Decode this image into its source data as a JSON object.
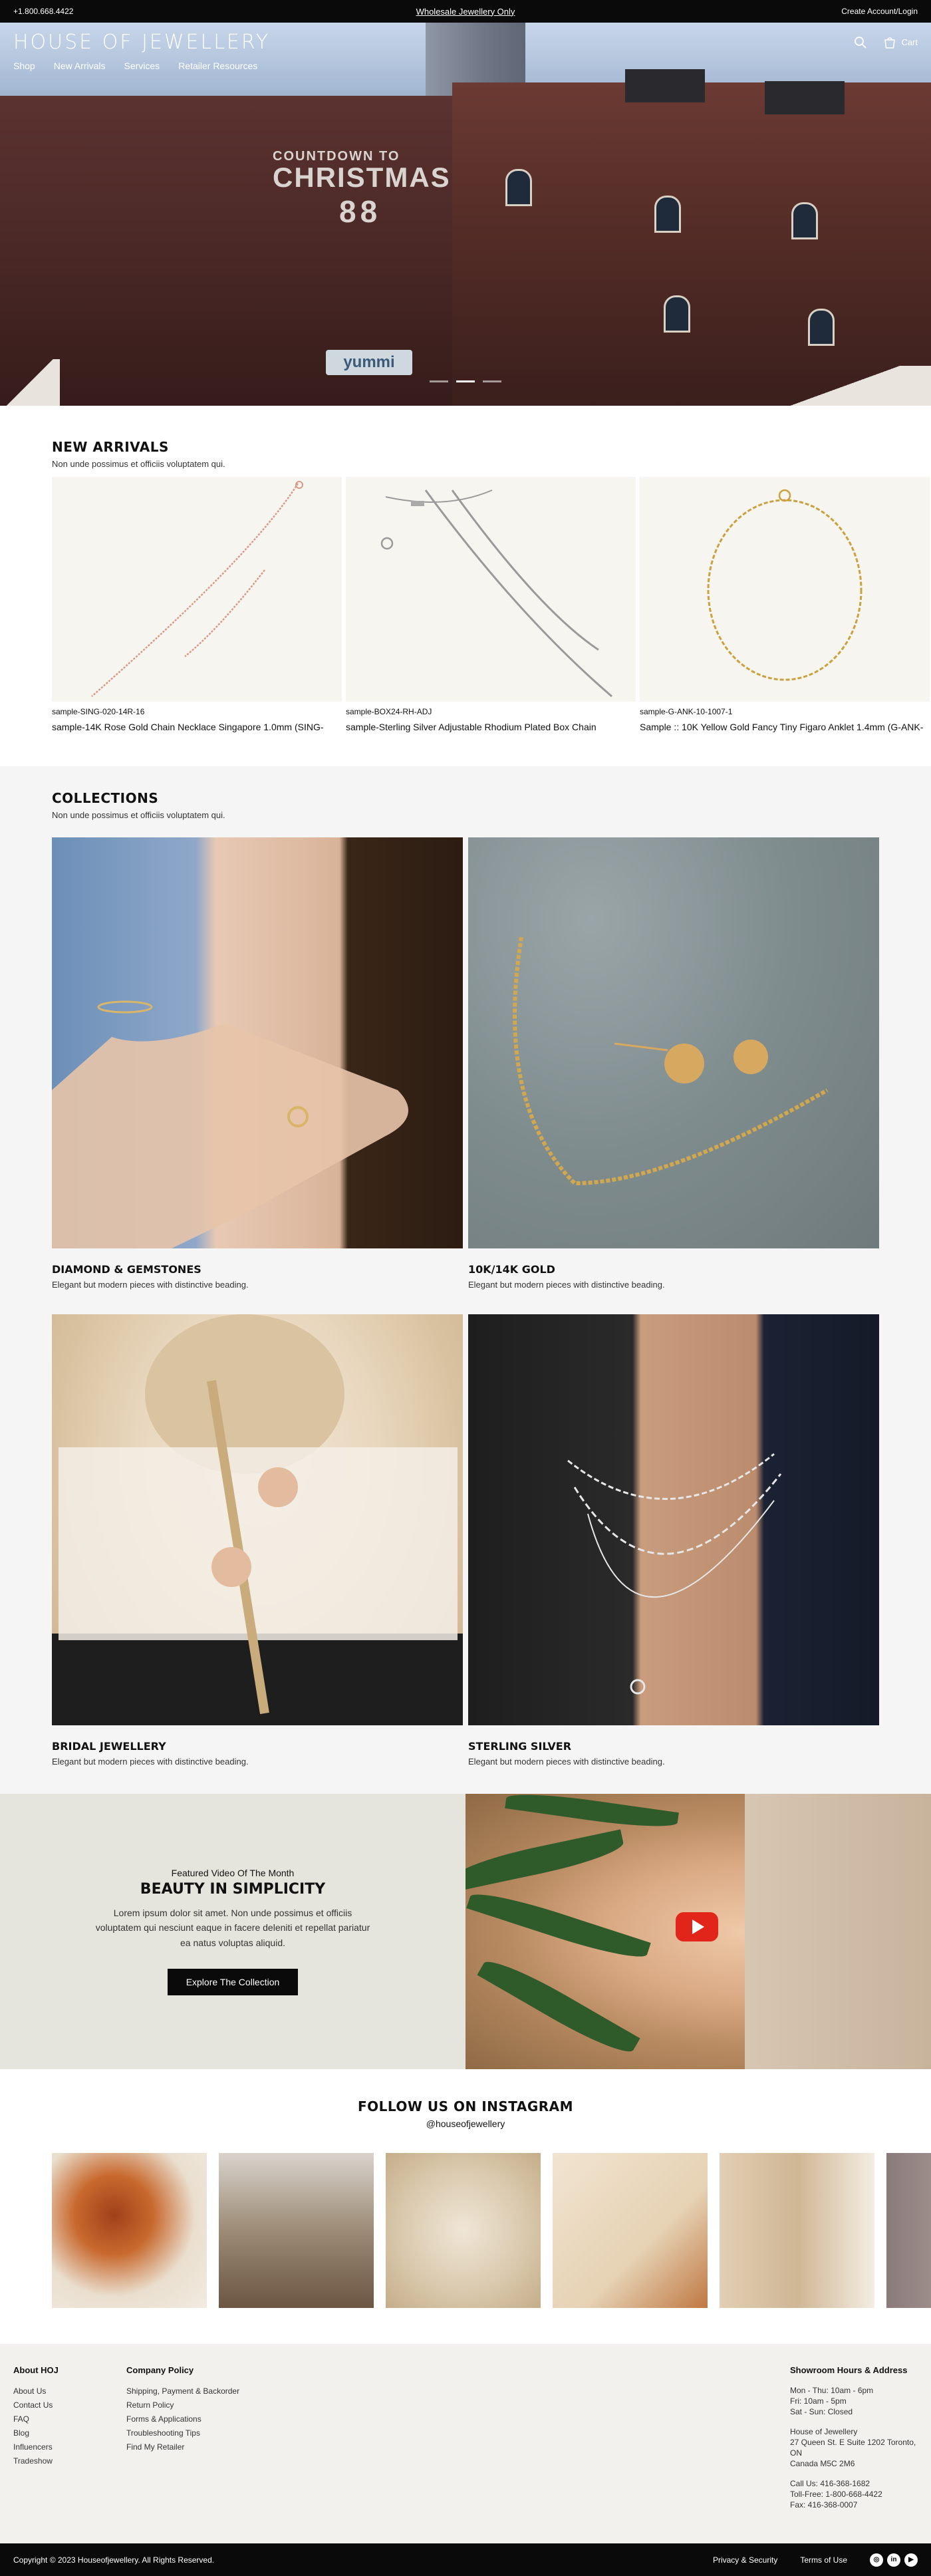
{
  "topbar": {
    "phone": "+1.800.668.4422",
    "wholesale_link": "Wholesale Jewellery Only",
    "account_link": "Create Account/Login"
  },
  "header": {
    "logo": "HOUSE OF JEWELLERY",
    "menu": [
      "Shop",
      "New Arrivals",
      "Services",
      "Retailer Resources"
    ],
    "cart_label": "Cart",
    "icons": [
      "search-icon",
      "cart-icon"
    ]
  },
  "hero": {
    "sign_line1": "COUNTDOWN TO",
    "sign_line2": "CHRISTMAS",
    "sign_line3": "88",
    "storefront_sign": "yummi",
    "slides": 3,
    "active_slide": 2
  },
  "new_arrivals": {
    "title": "NEW ARRIVALS",
    "subtitle": "Non unde possimus et officiis voluptatem qui.",
    "products": [
      {
        "sku": "sample-SING-020-14R-16",
        "name": "sample-14K Rose Gold Chain Necklace Singapore 1.0mm (SING-"
      },
      {
        "sku": "sample-BOX24-RH-ADJ",
        "name": "sample-Sterling Silver Adjustable Rhodium Plated Box Chain"
      },
      {
        "sku": "sample-G-ANK-10-1007-1",
        "name": "Sample :: 10K Yellow Gold Fancy Tiny Figaro Anklet 1.4mm (G-ANK-"
      }
    ]
  },
  "collections": {
    "title": "COLLECTIONS",
    "subtitle": "Non unde possimus et officiis voluptatem qui.",
    "items": [
      {
        "title": "DIAMOND & GEMSTONES",
        "desc": "Elegant but modern pieces with distinctive beading."
      },
      {
        "title": "10K/14K GOLD",
        "desc": "Elegant but modern pieces with distinctive beading."
      },
      {
        "title": "BRIDAL JEWELLERY",
        "desc": "Elegant but modern pieces with distinctive beading."
      },
      {
        "title": "STERLING SILVER",
        "desc": "Elegant but modern pieces with distinctive beading."
      }
    ]
  },
  "video": {
    "kicker": "Featured Video Of The Month",
    "title": "BEAUTY IN SIMPLICITY",
    "text": "Lorem ipsum dolor sit amet. Non unde possimus et officiis voluptatem qui nesciunt eaque in facere deleniti et repellat pariatur ea natus voluptas aliquid.",
    "button": "Explore The Collection"
  },
  "instagram": {
    "title": "FOLLOW US ON INSTAGRAM",
    "handle": "@houseofjewellery"
  },
  "footer": {
    "about": {
      "title": "About HOJ",
      "links": [
        "About Us",
        "Contact Us",
        "FAQ",
        "Blog",
        "Influencers",
        "Tradeshow"
      ]
    },
    "policy": {
      "title": "Company Policy",
      "links": [
        "Shipping, Payment & Backorder",
        "Return Policy",
        "Forms & Applications",
        "Troubleshooting Tips",
        "Find My Retailer"
      ]
    },
    "showroom": {
      "title": "Showroom Hours & Address",
      "hours1": "Mon - Thu: 10am - 6pm",
      "hours2": "Fri: 10am - 5pm",
      "hours3": "Sat - Sun: Closed",
      "addr1": "House of Jewellery",
      "addr2": "27 Queen St. E Suite 1202 Toronto,",
      "addr3": "ON",
      "addr4": "Canada M5C 2M6",
      "call": "Call Us: 416-368-1682",
      "tollfree": "Toll-Free: 1-800-668-4422",
      "fax": "Fax: 416-368-0007"
    }
  },
  "bottombar": {
    "copyright": "Copyright © 2023 Houseofjewellery. All Rights Reserved.",
    "privacy": "Privacy & Security",
    "terms": "Terms of Use",
    "socials": [
      "instagram-icon",
      "linkedin-icon",
      "youtube-icon"
    ]
  }
}
